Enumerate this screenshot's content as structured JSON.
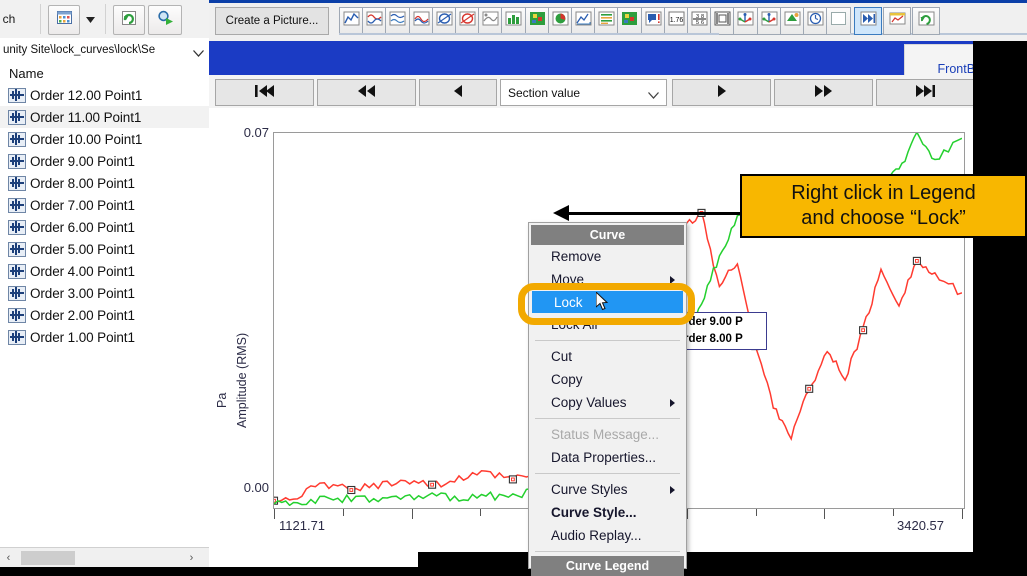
{
  "left_panel": {
    "toolbar": {
      "search_label": "ch",
      "icons": [
        "grid-view-icon",
        "chevron-down-icon",
        "refresh-icon",
        "search-go-icon"
      ]
    },
    "path": {
      "value": "unity Site\\lock_curves\\lock\\Se",
      "caret": "chevron-down-icon"
    },
    "column_header": "Name",
    "items": [
      {
        "label": "Order 12.00 Point1",
        "icon": "waveform-icon",
        "selected": false
      },
      {
        "label": "Order 11.00 Point1",
        "icon": "waveform-icon",
        "selected": true
      },
      {
        "label": "Order 10.00 Point1",
        "icon": "waveform-icon",
        "selected": false
      },
      {
        "label": "Order 9.00 Point1",
        "icon": "waveform-icon",
        "selected": false
      },
      {
        "label": "Order 8.00 Point1",
        "icon": "waveform-icon",
        "selected": false
      },
      {
        "label": "Order 7.00 Point1",
        "icon": "waveform-icon",
        "selected": false
      },
      {
        "label": "Order 6.00 Point1",
        "icon": "waveform-icon",
        "selected": false
      },
      {
        "label": "Order 5.00 Point1",
        "icon": "waveform-icon",
        "selected": false
      },
      {
        "label": "Order 4.00 Point1",
        "icon": "waveform-icon",
        "selected": false
      },
      {
        "label": "Order 3.00 Point1",
        "icon": "waveform-icon",
        "selected": false
      },
      {
        "label": "Order 2.00 Point1",
        "icon": "waveform-icon",
        "selected": false
      },
      {
        "label": "Order 1.00 Point1",
        "icon": "waveform-icon",
        "selected": false
      }
    ],
    "scrollbar": {
      "left_arrow": "‹",
      "right_arrow": "›"
    }
  },
  "top_toolbar": {
    "create_picture_label": "Create a Picture...",
    "icons": [
      "line-plot-icon",
      "overlay-plot-icon",
      "waterfall-plot-icon",
      "multi-curve-icon",
      "polar-plot-icon",
      "nyquist-plot-icon",
      "modal-shape-icon",
      "bar-chart-icon",
      "colormap-icon",
      "pie-chart-icon",
      "3d-surface-icon",
      "list-display-icon",
      "color-map-2-icon",
      "annotation-icon",
      "numeric-display-icon",
      "fraction-display-icon",
      "film-strip-icon",
      "geometry-icon",
      "geometry-axes-icon",
      "paint-icon",
      "clock-icon",
      "blank-panel-icon"
    ],
    "right_icons": [
      "step-forward-icon",
      "new-picture-icon",
      "refresh-icon"
    ],
    "selected_right_icon": "step-forward-icon"
  },
  "tab": {
    "label": "FrontBack"
  },
  "nav_strip": {
    "first_label": "⏮",
    "rewind_label": "⏪",
    "prev_label": "◀",
    "section_value": "Section value",
    "section_caret": "chevron-down-icon",
    "play_label": "▶",
    "forward_label": "⏩",
    "last_label": "⏭"
  },
  "chart_data": {
    "type": "line",
    "title": "",
    "xlabel": "",
    "ylabel": "Amplitude (RMS)",
    "yunit": "Pa",
    "xlim": [
      1121.71,
      3420.57
    ],
    "ylim": [
      0.0,
      0.07
    ],
    "ytick_labels": [
      "0.07",
      "0.00"
    ],
    "xtick_labels": [
      "1121.71",
      "3420.57"
    ],
    "grid": false,
    "legend_position": "inside-upper-left",
    "series": [
      {
        "name": "Order 9.00 P",
        "color": "#ff3b30",
        "locked_flag": "F",
        "marker": "square",
        "selected": true,
        "x": [
          1121.71,
          1200,
          1290,
          1380,
          1470,
          1560,
          1650,
          1740,
          1830,
          1920,
          2010,
          2100,
          2190,
          2250,
          2310,
          2370,
          2430,
          2490,
          2550,
          2610,
          2670,
          2730,
          2790,
          2850,
          2910,
          2970,
          3030,
          3090,
          3150,
          3210,
          3270,
          3330,
          3420.57
        ],
        "y": [
          0.001,
          0.002,
          0.004,
          0.003,
          0.004,
          0.005,
          0.004,
          0.005,
          0.006,
          0.005,
          0.006,
          0.009,
          0.013,
          0.018,
          0.024,
          0.033,
          0.044,
          0.052,
          0.055,
          0.041,
          0.046,
          0.03,
          0.019,
          0.013,
          0.022,
          0.029,
          0.024,
          0.033,
          0.044,
          0.038,
          0.046,
          0.043,
          0.04
        ]
      },
      {
        "name": "Order 8.00 P",
        "color": "#24d02e",
        "locked_flag": "F",
        "marker": "none",
        "selected": false,
        "x": [
          1121.71,
          1200,
          1290,
          1380,
          1470,
          1560,
          1650,
          1740,
          1830,
          1920,
          2010,
          2100,
          2190,
          2250,
          2310,
          2370,
          2430,
          2490,
          2550,
          2610,
          2670,
          2730,
          2790,
          2850,
          2910,
          2970,
          3030,
          3090,
          3150,
          3210,
          3270,
          3330,
          3420.57
        ],
        "y": [
          0.0005,
          0.0008,
          0.0012,
          0.0015,
          0.0012,
          0.0015,
          0.0018,
          0.0016,
          0.0018,
          0.002,
          0.003,
          0.005,
          0.008,
          0.011,
          0.014,
          0.016,
          0.021,
          0.029,
          0.038,
          0.047,
          0.054,
          0.056,
          0.055,
          0.055,
          0.055,
          0.055,
          0.056,
          0.057,
          0.06,
          0.063,
          0.07,
          0.065,
          0.069
        ]
      }
    ]
  },
  "legend": {
    "rows": [
      {
        "flag": "F",
        "filled": true,
        "color": "#ff3b30",
        "name": "Order 9.00 P"
      },
      {
        "flag": "F",
        "filled": false,
        "color": "#24d02e",
        "name": "Order 8.00 P"
      }
    ]
  },
  "context_menu": {
    "header": "Curve",
    "items": [
      {
        "label": "Remove",
        "type": "item"
      },
      {
        "label": "Move",
        "type": "submenu"
      },
      {
        "label": "Lock",
        "type": "highlighted"
      },
      {
        "label": "Lock All",
        "type": "item"
      },
      {
        "type": "separator"
      },
      {
        "label": "Cut",
        "type": "item"
      },
      {
        "label": "Copy",
        "type": "item"
      },
      {
        "label": "Copy Values",
        "type": "submenu"
      },
      {
        "type": "separator"
      },
      {
        "label": "Status Message...",
        "type": "disabled"
      },
      {
        "label": "Data Properties...",
        "type": "item"
      },
      {
        "type": "separator"
      },
      {
        "label": "Curve Styles",
        "type": "submenu"
      },
      {
        "label": "Curve Style...",
        "type": "bold"
      },
      {
        "label": "Audio Replay...",
        "type": "item"
      },
      {
        "type": "separator"
      },
      {
        "label": "Curve Legend",
        "type": "header"
      }
    ],
    "highlight_color": "#2196f3",
    "ring_color": "#f2a900"
  },
  "callout": {
    "line1": "Right click in Legend",
    "line2": "and choose “Lock”",
    "background": "#f8b700"
  }
}
